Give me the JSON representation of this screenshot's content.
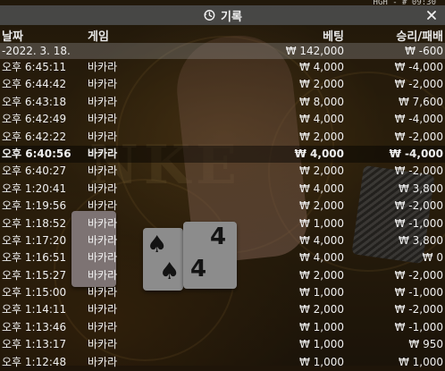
{
  "status": {
    "text": "HGH - # 09:30"
  },
  "title": {
    "label": "기록"
  },
  "columns": {
    "date": "날짜",
    "game": "게임",
    "bet": "베팅",
    "result": "승리/패배"
  },
  "summary": {
    "date": "-2022. 3. 18.",
    "game": "",
    "bet": "₩ 142,000",
    "result": "₩ -600"
  },
  "rows": [
    {
      "date": "오후 6:45:11",
      "game": "바카라",
      "bet": "₩ 4,000",
      "result": "₩ -4,000"
    },
    {
      "date": "오후 6:44:42",
      "game": "바카라",
      "bet": "₩ 2,000",
      "result": "₩ -2,000"
    },
    {
      "date": "오후 6:43:18",
      "game": "바카라",
      "bet": "₩ 8,000",
      "result": "₩ 7,600"
    },
    {
      "date": "오후 6:42:49",
      "game": "바카라",
      "bet": "₩ 4,000",
      "result": "₩ -4,000"
    },
    {
      "date": "오후 6:42:22",
      "game": "바카라",
      "bet": "₩ 2,000",
      "result": "₩ -2,000"
    },
    {
      "date": "오후 6:40:56",
      "game": "바카라",
      "bet": "₩ 4,000",
      "result": "₩ -4,000"
    },
    {
      "date": "오후 6:40:27",
      "game": "바카라",
      "bet": "₩ 2,000",
      "result": "₩ -2,000"
    },
    {
      "date": "오후 1:20:41",
      "game": "바카라",
      "bet": "₩ 4,000",
      "result": "₩ 3,800"
    },
    {
      "date": "오후 1:19:56",
      "game": "바카라",
      "bet": "₩ 2,000",
      "result": "₩ -2,000"
    },
    {
      "date": "오후 1:18:52",
      "game": "바카라",
      "bet": "₩ 1,000",
      "result": "₩ -1,000"
    },
    {
      "date": "오후 1:17:20",
      "game": "바카라",
      "bet": "₩ 4,000",
      "result": "₩ 3,800"
    },
    {
      "date": "오후 1:16:51",
      "game": "바카라",
      "bet": "₩ 4,000",
      "result": "₩ 0"
    },
    {
      "date": "오후 1:15:27",
      "game": "바카라",
      "bet": "₩ 2,000",
      "result": "₩ -2,000"
    },
    {
      "date": "오후 1:15:00",
      "game": "바카라",
      "bet": "₩ 1,000",
      "result": "₩ -1,000"
    },
    {
      "date": "오후 1:14:11",
      "game": "바카라",
      "bet": "₩ 2,000",
      "result": "₩ -2,000"
    },
    {
      "date": "오후 1:13:46",
      "game": "바카라",
      "bet": "₩ 1,000",
      "result": "₩ -1,000"
    },
    {
      "date": "오후 1:13:17",
      "game": "바카라",
      "bet": "₩ 1,000",
      "result": "₩ 950"
    },
    {
      "date": "오후 1:12:48",
      "game": "바카라",
      "bet": "₩ 1,000",
      "result": "₩ 1,000"
    }
  ],
  "highlighted_row": 5,
  "icons": {
    "title": "history-clock-icon",
    "close": "close-icon"
  },
  "colors": {
    "titlebar": "#4b4b4b",
    "summary_row": "#8a8a8a",
    "highlight_row": "#000000",
    "text": "#f0f0f0"
  }
}
